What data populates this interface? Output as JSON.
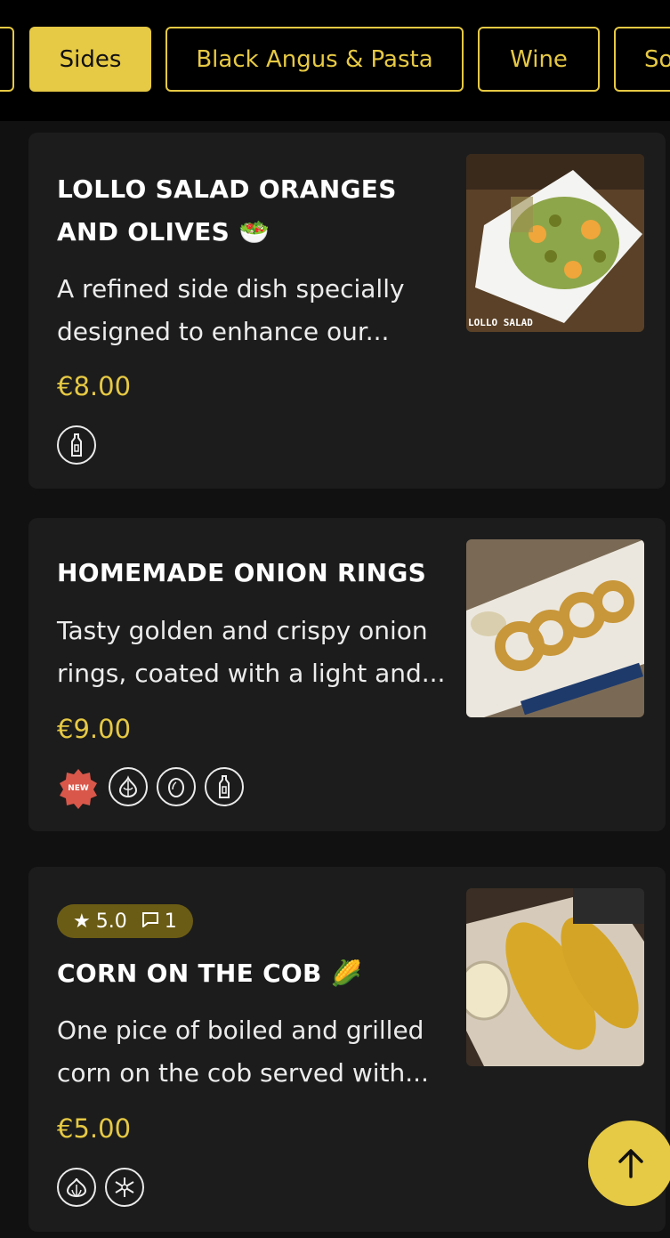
{
  "tabs": [
    {
      "label": ""
    },
    {
      "label": "Sides",
      "active": true
    },
    {
      "label": "Black Angus & Pasta"
    },
    {
      "label": "Wine"
    },
    {
      "label": "So"
    }
  ],
  "items": [
    {
      "title": "LOLLO SALAD ORANGES AND OLIVES",
      "emoji": "🥗",
      "description_line1": "A refined side dish specially",
      "description_line2": "designed to enhance our...",
      "price": "€8.00",
      "image_caption": "LOLLO SALAD",
      "icons": [
        "sauce-bottle-icon"
      ]
    },
    {
      "title": "HOMEMADE ONION RINGS",
      "description_line1": "Tasty golden and crispy onion",
      "description_line2": "rings, coated with a light and...",
      "price": "€9.00",
      "new_badge": "NEW",
      "icons": [
        "onion-icon",
        "egg-icon",
        "sauce-bottle-icon"
      ]
    },
    {
      "title": "CORN ON THE COB",
      "emoji": "🌽",
      "rating": "5.0",
      "comments": "1",
      "description_line1": "One pice of boiled and grilled",
      "description_line2": "corn on the cob served with...",
      "price": "€5.00",
      "icons": [
        "garlic-icon",
        "frozen-snowflake-icon"
      ]
    }
  ],
  "colors": {
    "accent": "#e6c944",
    "card": "#1c1c1c",
    "background": "#111111",
    "new_badge": "#d9574a"
  }
}
